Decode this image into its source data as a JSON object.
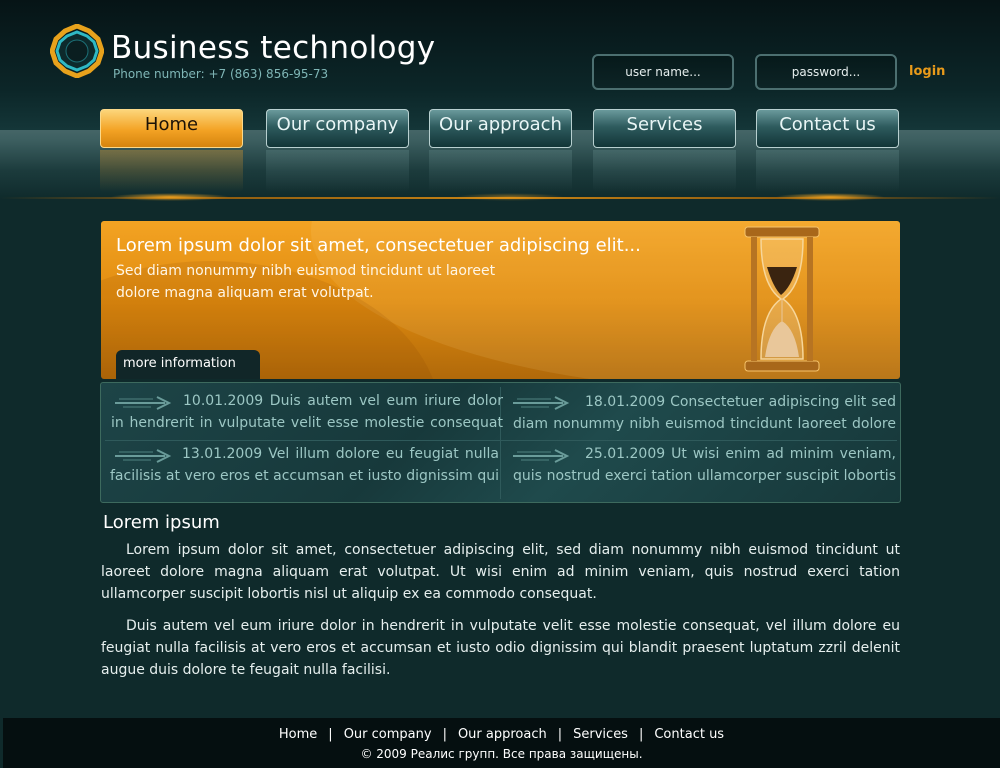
{
  "header": {
    "site_title": "Business technology",
    "phone": "Phone number: +7 (863) 856-95-73"
  },
  "login": {
    "username_placeholder": "user name...",
    "password_placeholder": "password...",
    "login_label": "login"
  },
  "nav": {
    "items": [
      {
        "label": "Home",
        "active": true
      },
      {
        "label": "Our company"
      },
      {
        "label": "Our approach"
      },
      {
        "label": "Services"
      },
      {
        "label": "Contact us"
      }
    ]
  },
  "banner": {
    "title": "Lorem ipsum dolor sit amet, consectetuer adipiscing elit...",
    "text": "Sed diam nonummy nibh euismod tincidunt ut laoreet dolore magna aliquam erat volutpat.",
    "more_label": "more information >>"
  },
  "news": [
    {
      "text": "10.01.2009 Duis autem vel eum iriure dolor in hendrerit in vulputate velit esse molestie consequat"
    },
    {
      "text": "18.01.2009 Consectetuer adipiscing elit sed diam nonummy nibh euismod tincidunt laoreet dolore"
    },
    {
      "text": "13.01.2009 Vel illum dolore eu feugiat nulla facilisis at vero eros et accumsan et iusto dignissim qui"
    },
    {
      "text": "25.01.2009 Ut wisi enim ad minim veniam, quis nostrud exerci tation ullamcorper suscipit lobortis"
    }
  ],
  "content": {
    "title": "Lorem ipsum",
    "paragraphs": [
      "Lorem ipsum dolor sit amet, consectetuer adipiscing elit, sed diam nonummy nibh euismod tincidunt ut laoreet dolore magna aliquam erat volutpat. Ut wisi enim ad minim veniam, quis nostrud exerci tation ullamcorper suscipit lobortis nisl ut aliquip ex ea commodo consequat.",
      "Duis autem vel eum iriure dolor in hendrerit in vulputate velit esse molestie consequat, vel illum dolore eu feugiat nulla facilisis at vero eros et accumsan et iusto odio dignissim qui blandit praesent luptatum zzril delenit augue duis dolore te feugait nulla facilisi."
    ]
  },
  "footer": {
    "links": [
      "Home",
      "Our company",
      "Our approach",
      "Services",
      "Contact us"
    ],
    "separator": "|",
    "copyright": "© 2009 Реалис групп. Все права защищены."
  },
  "colors": {
    "accent_orange": "#f3a224",
    "background": "#0f2a2b",
    "login_link": "#e89a1a"
  }
}
